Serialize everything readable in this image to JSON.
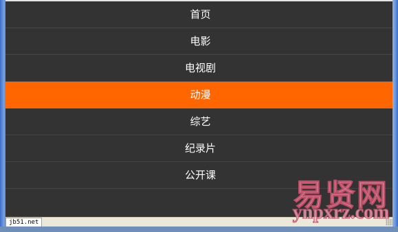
{
  "menu": {
    "items": [
      {
        "label": "首页"
      },
      {
        "label": "电影"
      },
      {
        "label": "电视剧"
      },
      {
        "label": "动漫",
        "active": true
      },
      {
        "label": "综艺"
      },
      {
        "label": "纪录片"
      },
      {
        "label": "公开课"
      }
    ]
  },
  "statusbar": {
    "zone": "jb51.net"
  },
  "watermark": {
    "line1": "易贤网",
    "line2": "ynpxrz.com"
  },
  "colors": {
    "active_bg": "#ff6600",
    "menu_bg": "#333333",
    "divider": "#444444"
  }
}
